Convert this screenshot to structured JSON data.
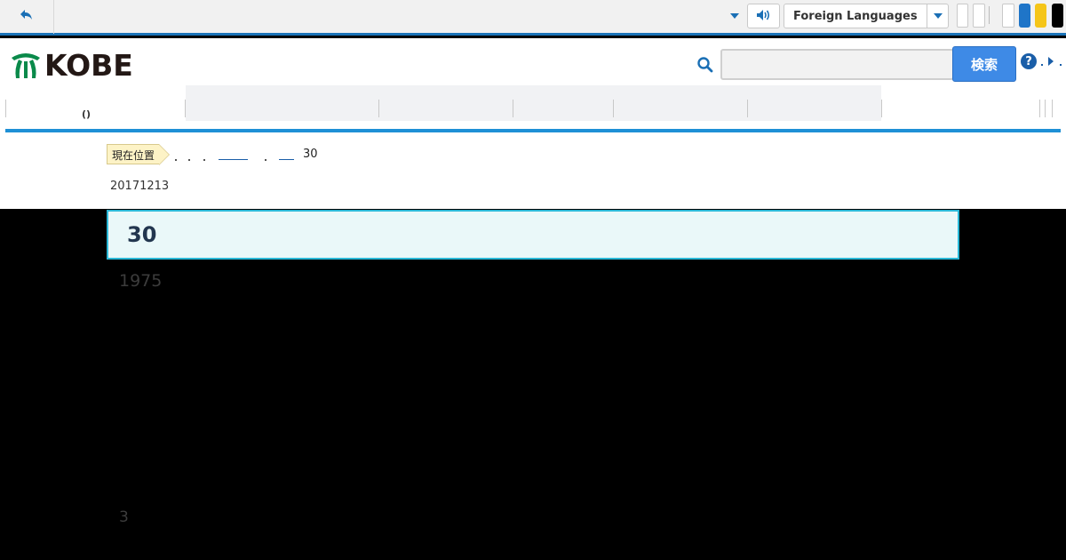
{
  "topbar": {
    "back_icon": "undo-icon",
    "speak_icon": "speaker-icon",
    "language_select": "Foreign Languages",
    "colors": {
      "accent": "#1a73b8",
      "swatch_blue": "#1f75c8",
      "swatch_yellow": "#f5c518",
      "swatch_black": "#000000"
    }
  },
  "header": {
    "logo_text": "KOBE",
    "search": {
      "placeholder": "",
      "button_label": "検索"
    },
    "help_label": "?"
  },
  "nav": {
    "first_item": "()"
  },
  "breadcrumb": {
    "label": "現在位置",
    "current": "30"
  },
  "article": {
    "date": "20171213",
    "title": "30",
    "year_text": "1975",
    "footnote": "3"
  }
}
